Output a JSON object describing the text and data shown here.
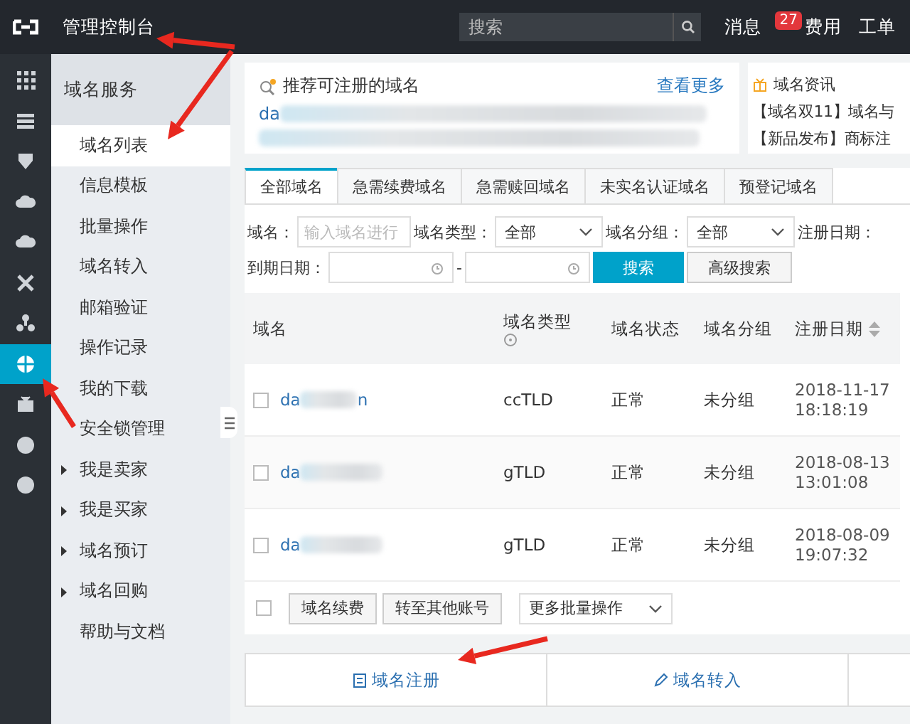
{
  "topbar": {
    "title": "管理控制台",
    "search_placeholder": "搜索",
    "links": [
      {
        "label": "消息",
        "badge": "27"
      },
      {
        "label": "费用"
      },
      {
        "label": "工单"
      }
    ]
  },
  "rail": {
    "items": [
      {
        "kind": "grid",
        "selected": false
      },
      {
        "kind": "list",
        "selected": false
      },
      {
        "kind": "shield",
        "selected": false
      },
      {
        "kind": "cloud",
        "selected": false
      },
      {
        "kind": "cloud",
        "selected": false
      },
      {
        "kind": "cross",
        "selected": false
      },
      {
        "kind": "nodes",
        "selected": false
      },
      {
        "kind": "globe",
        "selected": true
      },
      {
        "kind": "box",
        "selected": false
      },
      {
        "kind": "dot",
        "selected": false
      },
      {
        "kind": "dot",
        "selected": false
      }
    ]
  },
  "sidebar": {
    "title": "域名服务",
    "items": [
      {
        "label": "域名列表",
        "selected": true,
        "expandable": false
      },
      {
        "label": "信息模板",
        "selected": false,
        "expandable": false
      },
      {
        "label": "批量操作",
        "selected": false,
        "expandable": false
      },
      {
        "label": "域名转入",
        "selected": false,
        "expandable": false
      },
      {
        "label": "邮箱验证",
        "selected": false,
        "expandable": false
      },
      {
        "label": "操作记录",
        "selected": false,
        "expandable": false
      },
      {
        "label": "我的下载",
        "selected": false,
        "expandable": false
      },
      {
        "label": "安全锁管理",
        "selected": false,
        "expandable": false
      },
      {
        "label": "我是卖家",
        "selected": false,
        "expandable": true
      },
      {
        "label": "我是买家",
        "selected": false,
        "expandable": true
      },
      {
        "label": "域名预订",
        "selected": false,
        "expandable": true
      },
      {
        "label": "域名回购",
        "selected": false,
        "expandable": true
      },
      {
        "label": "帮助与文档",
        "selected": false,
        "expandable": false
      }
    ]
  },
  "recommend": {
    "title": "推荐可注册的域名",
    "more": "查看更多",
    "domain": "da"
  },
  "news": {
    "title": "域名资讯",
    "items": [
      "【域名双11】域名与",
      "【新品发布】商标注"
    ]
  },
  "tabs": [
    {
      "label": "全部域名",
      "selected": true
    },
    {
      "label": "急需续费域名",
      "selected": false
    },
    {
      "label": "急需赎回域名",
      "selected": false
    },
    {
      "label": "未实名认证域名",
      "selected": false
    },
    {
      "label": "预登记域名",
      "selected": false
    }
  ],
  "filters": {
    "name_label": "域名：",
    "name_placeholder": "输入域名进行",
    "type_label": "域名类型：",
    "type_value": "全部",
    "group_label": "域名分组：",
    "group_value": "全部",
    "reg_label": "注册日期：",
    "expiry_label": "到期日期：",
    "range_dash": "-",
    "search": "搜索",
    "advanced": "高级搜索"
  },
  "table": {
    "columns": [
      {
        "label": "域名"
      },
      {
        "label": "域名类型",
        "help": true
      },
      {
        "label": "域名状态"
      },
      {
        "label": "域名分组"
      },
      {
        "label": "注册日期",
        "sortable": true
      }
    ],
    "rows": [
      {
        "checked": false,
        "domain": "da",
        "domain_end": "n",
        "type": "ccTLD",
        "status": "正常",
        "group": "未分组",
        "date": "2018-11-17",
        "time": "18:18:19"
      },
      {
        "checked": false,
        "domain": "da",
        "type": "gTLD",
        "status": "正常",
        "group": "未分组",
        "date": "2018-08-13",
        "time": "13:01:08"
      },
      {
        "checked": false,
        "domain": "da",
        "type": "gTLD",
        "status": "正常",
        "group": "未分组",
        "date": "2018-08-09",
        "time": "19:07:32"
      }
    ]
  },
  "bulk": {
    "checked": false,
    "buttons": [
      "域名续费",
      "转至其他账号"
    ],
    "more": "更多批量操作"
  },
  "actions": [
    {
      "kind": "register",
      "label": "域名注册"
    },
    {
      "kind": "transfer",
      "label": "域名转入"
    }
  ]
}
